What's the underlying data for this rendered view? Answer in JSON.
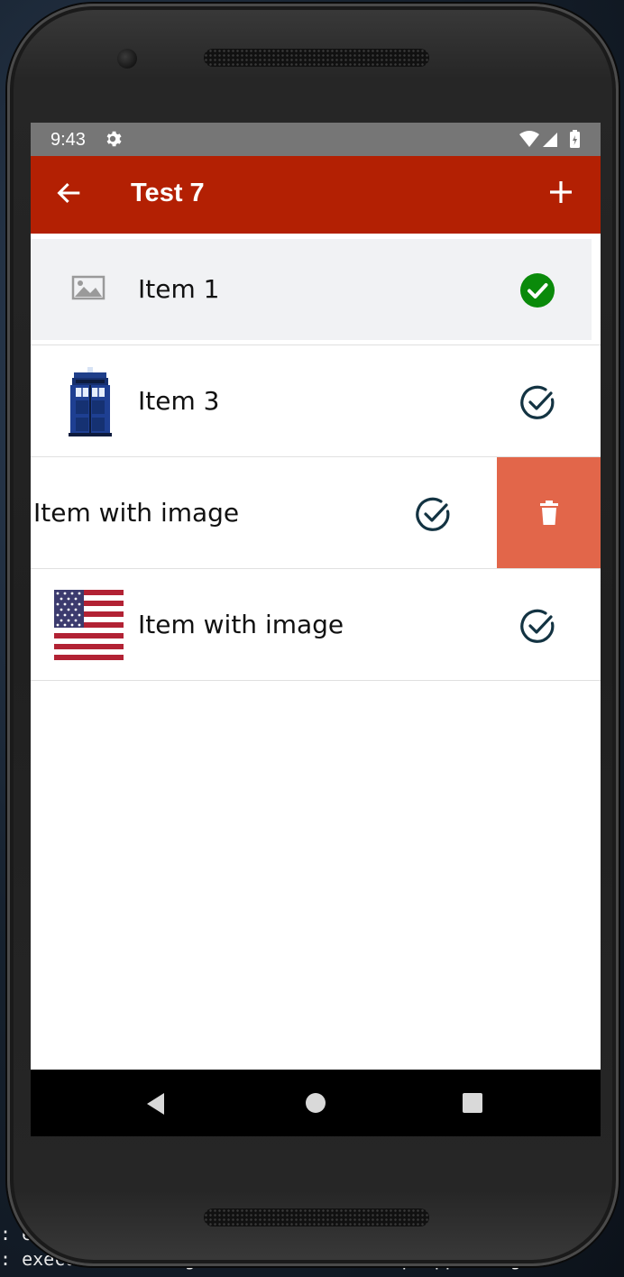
{
  "status_bar": {
    "time": "9:43",
    "icons": [
      "gear-icon",
      "wifi-icon",
      "signal-icon",
      "battery-charging-icon"
    ]
  },
  "app_bar": {
    "title": "Test 7",
    "back_icon": "arrow-left-icon",
    "add_icon": "plus-icon"
  },
  "list": {
    "items": [
      {
        "label": "Item 1",
        "thumbnail": "image-placeholder-icon",
        "status": "checked-filled",
        "selected": true
      },
      {
        "label": "Item 3",
        "thumbnail": "police-box-image",
        "status": "check-outline"
      },
      {
        "label": "Item with image",
        "thumbnail": "none",
        "status": "check-outline",
        "swiped": true,
        "action": "trash-icon"
      },
      {
        "label": "Item with image",
        "thumbnail": "us-flag-image",
        "status": "check-outline"
      }
    ]
  },
  "nav_bar": {
    "icons": [
      "nav-back-icon",
      "nav-home-icon",
      "nav-recents-icon"
    ]
  },
  "background_terminal": {
    "lines": [
      ": ex",
      ": execute: running rm \"/data/local/tmp/app-debug.a"
    ]
  },
  "colors": {
    "app_bar": "#b32003",
    "delete_action": "#e2664a",
    "check_filled": "#0a8a0a",
    "check_outline": "#133342"
  }
}
